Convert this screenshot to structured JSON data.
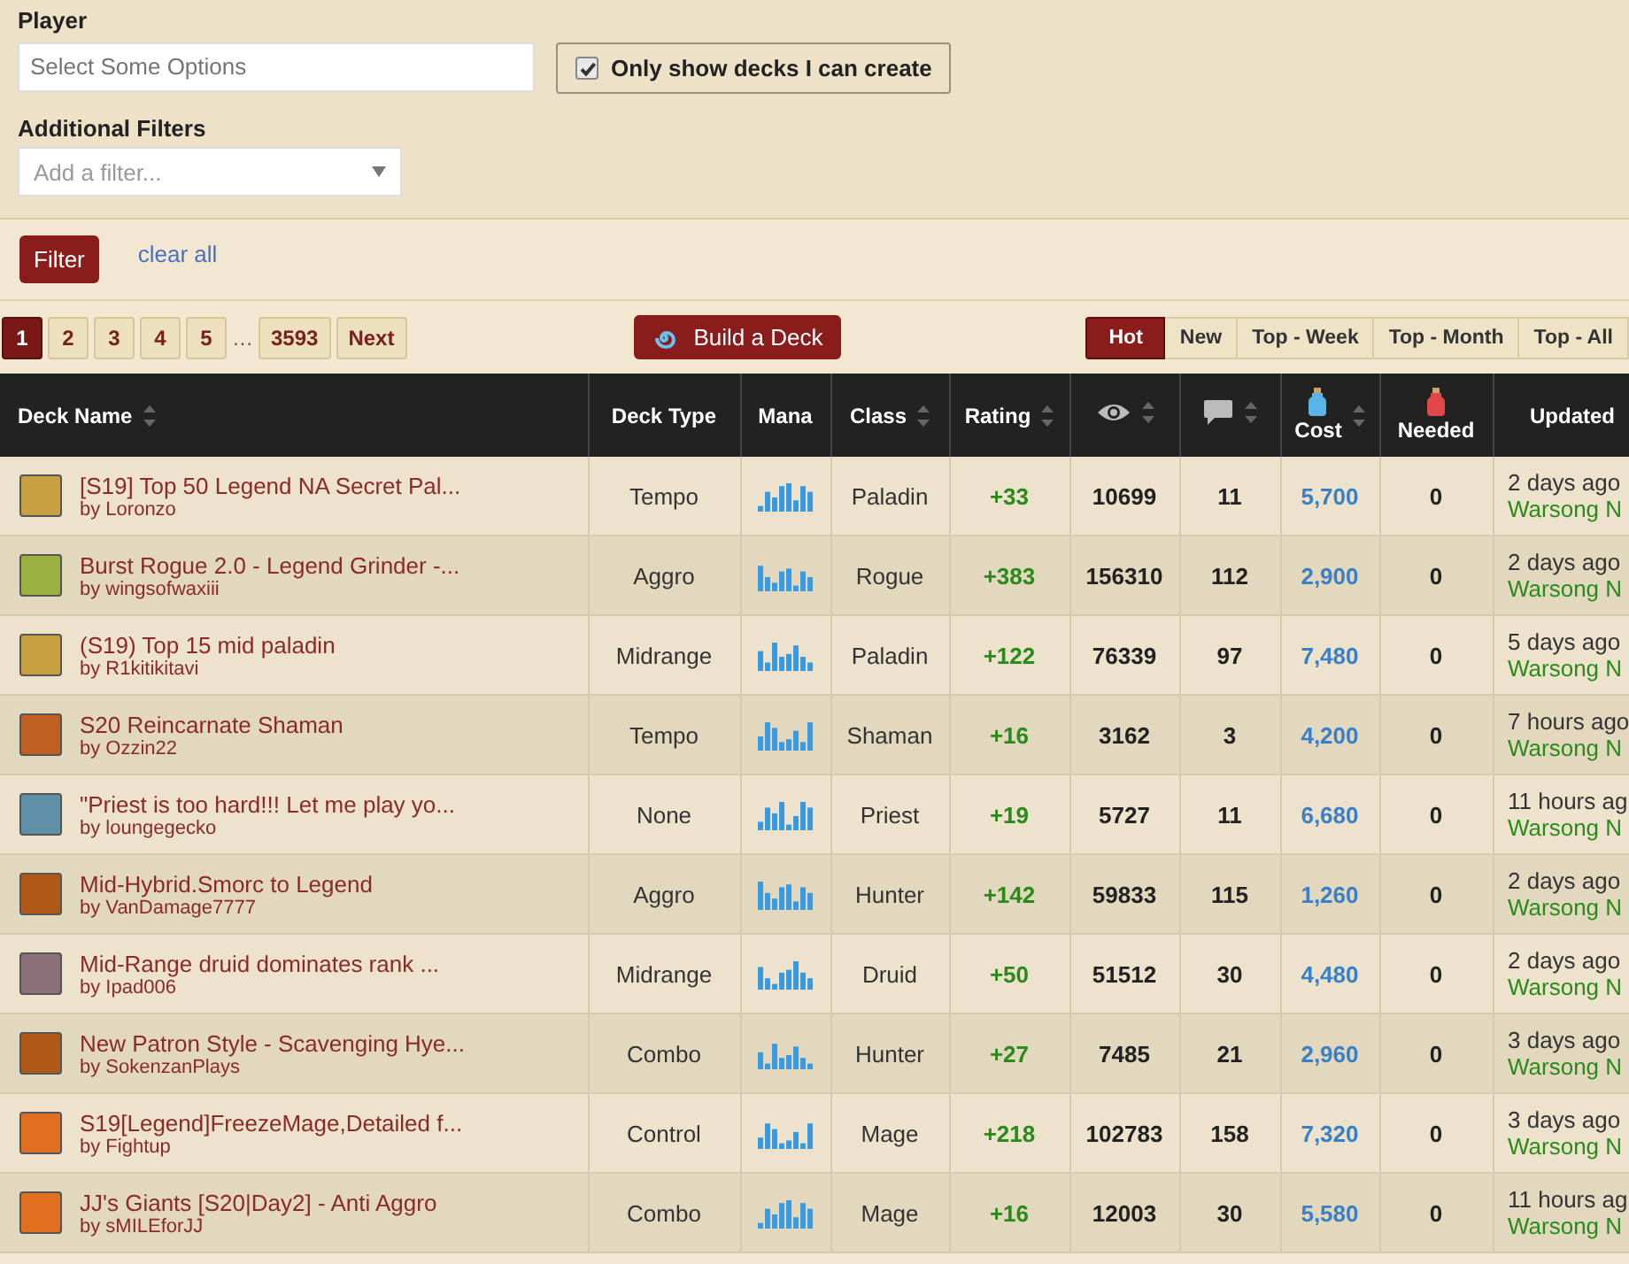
{
  "filters": {
    "player": {
      "label": "Player",
      "placeholder": "Select Some Options"
    },
    "only_creatable": {
      "label": "Only show decks I can create",
      "checked": true
    },
    "additional": {
      "label": "Additional Filters",
      "placeholder": "Add a filter..."
    },
    "filter_button": "Filter",
    "clear_link": "clear all"
  },
  "pagination": {
    "pages": [
      {
        "label": "1",
        "selected": true
      },
      {
        "label": "2",
        "selected": false
      },
      {
        "label": "3",
        "selected": false
      },
      {
        "label": "4",
        "selected": false
      },
      {
        "label": "5",
        "selected": false
      }
    ],
    "ellipsis": "…",
    "last_page": {
      "label": "3593",
      "selected": false
    },
    "next": "Next"
  },
  "build_button": "Build a Deck",
  "sort_tabs": [
    {
      "label": "Hot",
      "selected": true
    },
    {
      "label": "New",
      "selected": false
    },
    {
      "label": "Top - Week",
      "selected": false
    },
    {
      "label": "Top - Month",
      "selected": false
    },
    {
      "label": "Top - All",
      "selected": false
    }
  ],
  "table": {
    "columns": [
      {
        "kind": "text",
        "label": "Deck Name",
        "sortable": true
      },
      {
        "kind": "text",
        "label": "Deck Type",
        "sortable": false
      },
      {
        "kind": "text",
        "label": "Mana",
        "sortable": false
      },
      {
        "kind": "text",
        "label": "Class",
        "sortable": true
      },
      {
        "kind": "text",
        "label": "Rating",
        "sortable": true
      },
      {
        "kind": "views",
        "sortable": true
      },
      {
        "kind": "comments",
        "sortable": true
      },
      {
        "kind": "cost",
        "label": "Cost",
        "sortable": true
      },
      {
        "kind": "needed",
        "label": "Needed",
        "sortable": false
      },
      {
        "kind": "text",
        "label": "Updated",
        "sortable": false
      }
    ],
    "rows": [
      {
        "name": "[S19] Top 50 Legend NA Secret Pal...",
        "byline": "by Loronzo",
        "color": "#c8a040",
        "type": "Tempo",
        "class": "Paladin",
        "rating": "+33",
        "views": "10699",
        "comments": "11",
        "cost": "5,700",
        "needed": "0",
        "updated": "2 days ago",
        "updater": "Warsong N"
      },
      {
        "name": "Burst Rogue 2.0 - Legend Grinder -...",
        "byline": "by wingsofwaxiii",
        "color": "#9ab040",
        "type": "Aggro",
        "class": "Rogue",
        "rating": "+383",
        "views": "156310",
        "comments": "112",
        "cost": "2,900",
        "needed": "0",
        "updated": "2 days ago",
        "updater": "Warsong N"
      },
      {
        "name": "(S19) Top 15 mid paladin",
        "byline": "by R1kitikitavi",
        "color": "#c8a040",
        "type": "Midrange",
        "class": "Paladin",
        "rating": "+122",
        "views": "76339",
        "comments": "97",
        "cost": "7,480",
        "needed": "0",
        "updated": "5 days ago",
        "updater": "Warsong N"
      },
      {
        "name": "S20 Reincarnate Shaman",
        "byline": "by Ozzin22",
        "color": "#c06020",
        "type": "Tempo",
        "class": "Shaman",
        "rating": "+16",
        "views": "3162",
        "comments": "3",
        "cost": "4,200",
        "needed": "0",
        "updated": "7 hours ago",
        "updater": "Warsong N"
      },
      {
        "name": "\"Priest is too hard!!! Let me play yo...",
        "byline": "by loungegecko",
        "color": "#6090a8",
        "type": "None",
        "class": "Priest",
        "rating": "+19",
        "views": "5727",
        "comments": "11",
        "cost": "6,680",
        "needed": "0",
        "updated": "11 hours ag",
        "updater": "Warsong N"
      },
      {
        "name": "Mid-Hybrid.Smorc to Legend",
        "byline": "by VanDamage7777",
        "color": "#b05818",
        "type": "Aggro",
        "class": "Hunter",
        "rating": "+142",
        "views": "59833",
        "comments": "115",
        "cost": "1,260",
        "needed": "0",
        "updated": "2 days ago",
        "updater": "Warsong N"
      },
      {
        "name": "Mid-Range druid dominates rank ...",
        "byline": "by Ipad006",
        "color": "#8a7078",
        "type": "Midrange",
        "class": "Druid",
        "rating": "+50",
        "views": "51512",
        "comments": "30",
        "cost": "4,480",
        "needed": "0",
        "updated": "2 days ago",
        "updater": "Warsong N"
      },
      {
        "name": "New Patron Style - Scavenging Hye...",
        "byline": "by SokenzanPlays",
        "color": "#b05818",
        "type": "Combo",
        "class": "Hunter",
        "rating": "+27",
        "views": "7485",
        "comments": "21",
        "cost": "2,960",
        "needed": "0",
        "updated": "3 days ago",
        "updater": "Warsong N"
      },
      {
        "name": "S19[Legend]FreezeMage,Detailed f...",
        "byline": "by Fightup",
        "color": "#e07020",
        "type": "Control",
        "class": "Mage",
        "rating": "+218",
        "views": "102783",
        "comments": "158",
        "cost": "7,320",
        "needed": "0",
        "updated": "3 days ago",
        "updater": "Warsong N"
      },
      {
        "name": "JJ's Giants [S20|Day2] - Anti Aggro",
        "byline": "by sMILEforJJ",
        "color": "#e07020",
        "type": "Combo",
        "class": "Mage",
        "rating": "+16",
        "views": "12003",
        "comments": "30",
        "cost": "5,580",
        "needed": "0",
        "updated": "11 hours ag",
        "updater": "Warsong N"
      }
    ]
  }
}
